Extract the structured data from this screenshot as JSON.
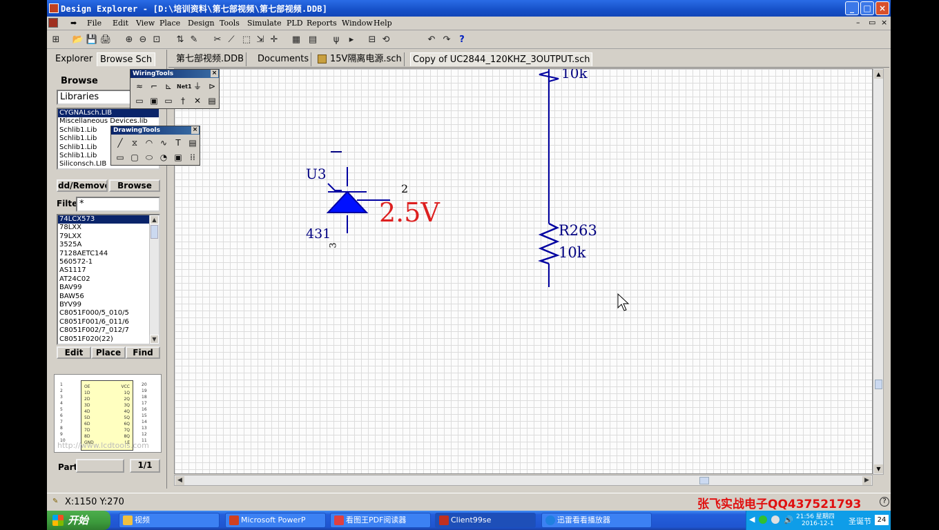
{
  "window": {
    "title": "Design Explorer - [D:\\培训资料\\第七部视频\\第七部视频.DDB]",
    "buttons": {
      "minimize": "_",
      "maximize": "□",
      "close": "×"
    }
  },
  "menu": {
    "items": [
      "File",
      "Edit",
      "View",
      "Place",
      "Design",
      "Tools",
      "Simulate",
      "PLD",
      "Reports",
      "Window",
      "Help"
    ],
    "mdi_min": "–",
    "mdi_restore": "▭",
    "mdi_close": "×"
  },
  "toolbar": {
    "icons": [
      "hierarchy-icon",
      "open-icon",
      "save-icon",
      "print-icon",
      "zoom-in-icon",
      "zoom-out-icon",
      "zoom-fit-icon",
      "up-down-icon",
      "edit-icon",
      "cut-icon",
      "wire-icon",
      "select-icon",
      "move-icon",
      "cross-icon",
      "chip-icon",
      "netlist-icon",
      "probe-icon",
      "run-icon",
      "component-icon",
      "rotate-icon",
      "undo-icon",
      "redo-icon",
      "help-icon"
    ],
    "glyphs": [
      "⊞",
      "📂",
      "💾",
      "🖨",
      "⊕",
      "⊖",
      "⊡",
      "⇅",
      "✎",
      "✂",
      "⟋",
      "⬚",
      "⇲",
      "✛",
      "▦",
      "▤",
      "ψ",
      "▸",
      "⊟",
      "⟲",
      "↶",
      "↷",
      "?"
    ]
  },
  "left_panel": {
    "tabs": [
      "Explorer",
      "Browse Sch"
    ],
    "browse_label": "Browse",
    "browse_combo": "Libraries",
    "libraries": [
      "CYGNALsch.LIB",
      "Miscellaneous Devices.lib",
      "Schlib1.Lib",
      "Schlib1.Lib",
      "Schlib1.Lib",
      "Schlib1.Lib",
      "Siliconsch.LIB"
    ],
    "buttons": {
      "add_remove": "dd/Remove",
      "browse": "Browse"
    },
    "filter_label": "Filte",
    "filter_value": "*",
    "components": [
      "74LCX573",
      "78LXX",
      "79LXX",
      "3525A",
      "7128AETC144",
      "560572-1",
      "AS1117",
      "AT24C02",
      "BAV99",
      "BAW56",
      "BYV99",
      "C8051F000/5_010/5",
      "C8051F001/6_011/6",
      "C8051F002/7_012/7",
      "C8051F020(22)"
    ],
    "comp_buttons": {
      "edit": "Edit",
      "place": "Place",
      "find": "Find"
    },
    "part_label": "Part",
    "part_page": "1/1",
    "preview_left": [
      "1",
      "2",
      "3",
      "4",
      "5",
      "6",
      "7",
      "8",
      "9",
      "10"
    ],
    "preview_right": [
      "20",
      "19",
      "18",
      "17",
      "16",
      "15",
      "14",
      "13",
      "12",
      "11"
    ],
    "preview_pins_left": [
      "OE",
      "1D",
      "2D",
      "3D",
      "4D",
      "5D",
      "6D",
      "7D",
      "8D",
      "GND"
    ],
    "preview_pins_right": [
      "VCC",
      "1Q",
      "2Q",
      "3Q",
      "4Q",
      "5Q",
      "6Q",
      "7Q",
      "8Q",
      "LE"
    ],
    "watermark": "http://www.lcdtools.com"
  },
  "wiring_tools": {
    "title": "WiringTools",
    "icons": [
      "wire-tool-icon",
      "bus-tool-icon",
      "bus-entry-icon",
      "net-label-icon",
      "ground-icon",
      "port-icon",
      "part-icon",
      "sheet-symbol-icon",
      "sheet-entry-icon",
      "junction-icon",
      "no-erc-icon",
      "pcb-layout-icon"
    ],
    "glyphs": [
      "≈",
      "⌐",
      "⊾",
      "Net1",
      "⏚",
      "⊳",
      "▭",
      "▣",
      "▭",
      "†",
      "✕",
      "▤"
    ]
  },
  "drawing_tools": {
    "title": "DrawingTools",
    "icons": [
      "line-icon",
      "polygon-icon",
      "arc-icon",
      "bezier-icon",
      "text-icon",
      "text-frame-icon",
      "rectangle-icon",
      "round-rect-icon",
      "ellipse-icon",
      "pie-icon",
      "graphic-icon",
      "array-icon"
    ],
    "glyphs": [
      "╱",
      "⧖",
      "◠",
      "∿",
      "T",
      "▤",
      "▭",
      "▢",
      "⬭",
      "◔",
      "▣",
      "⁞⁞"
    ]
  },
  "doc_tabs": [
    "第七部视频.DDB",
    "Documents",
    "15V隔离电源.sch",
    "Copy of UC2844_120KHZ_3OUTPUT.sch"
  ],
  "schematic": {
    "u3_designator": "U3",
    "u3_value": "431",
    "pin_2": "2",
    "pin_3": "3",
    "pin_minus": "—",
    "voltage_note": "2.5V",
    "r_top_value": "10k",
    "r263_designator": "R263",
    "r263_value": "10k",
    "colors": {
      "wire": "#0000a0",
      "component": "#0000ff",
      "annotation": "#dd2020",
      "text": "#000080"
    }
  },
  "status": {
    "coords": "X:1150 Y:270",
    "brand": "张飞实战电子QQ437521793",
    "help": "?"
  },
  "taskbar": {
    "start": "开始",
    "items": [
      "视频",
      "Microsoft PowerP",
      "看图王PDF阅读器",
      "Client99se",
      "迅雷看看播放器"
    ],
    "time": "21:56 星期四",
    "date": "2016-12-1",
    "ime": "圣诞节",
    "num": "24"
  }
}
